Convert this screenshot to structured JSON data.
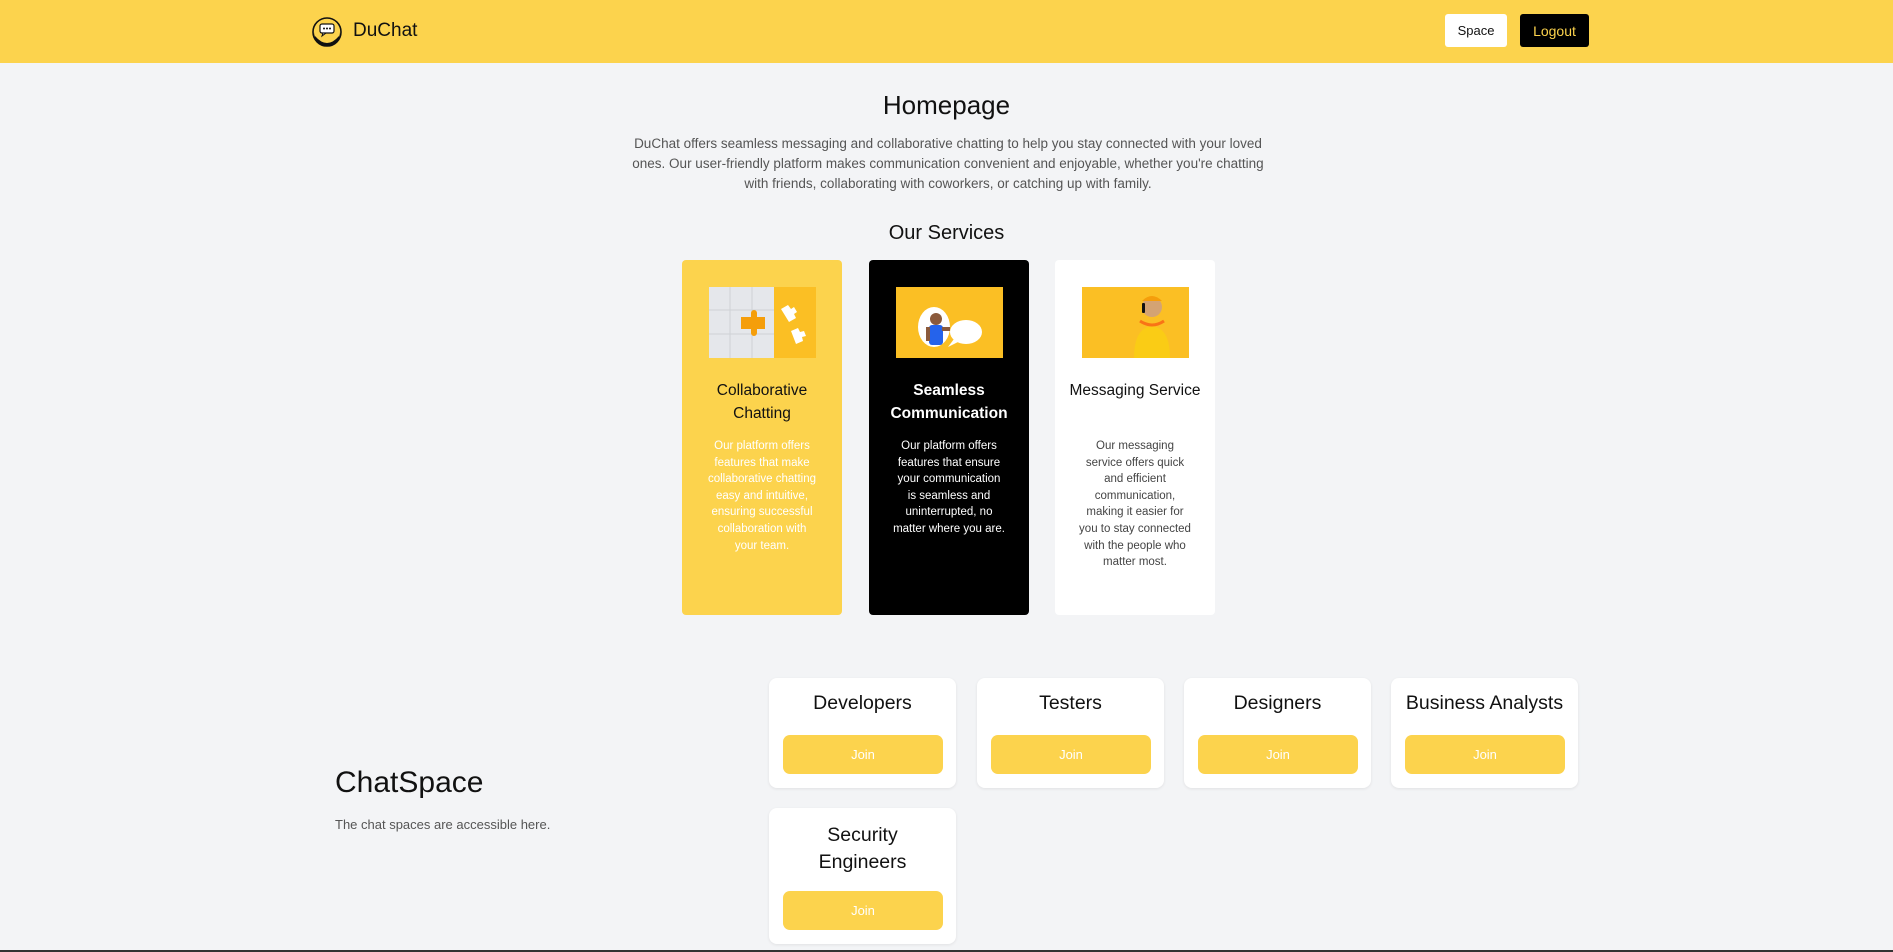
{
  "header": {
    "brand_name": "DuChat",
    "space_label": "Space",
    "logout_label": "Logout"
  },
  "hero": {
    "title": "Homepage",
    "intro": "DuChat offers seamless messaging and collaborative chatting to help you stay connected with your loved ones. Our user-friendly platform makes communication convenient and enjoyable, whether you're chatting with friends, collaborating with coworkers, or catching up with family."
  },
  "services": {
    "title": "Our Services",
    "items": [
      {
        "title": "Collaborative Chatting",
        "description": "Our platform offers features that make collaborative chatting easy and intuitive, ensuring successful collaboration with your team.",
        "image": "puzzle-pieces-image"
      },
      {
        "title": "Seamless Communication",
        "description": "Our platform offers features that ensure your communication is seamless and uninterrupted, no matter where you are.",
        "image": "man-with-speech-bubble-image"
      },
      {
        "title": "Messaging Service",
        "description": "Our messaging service offers quick and efficient communication, making it easier for you to stay connected with the people who matter most.",
        "image": "man-on-phone-image"
      }
    ]
  },
  "chatspace": {
    "title": "ChatSpace",
    "subtitle": "The chat spaces are accessible here.",
    "join_label": "Join",
    "spaces": [
      {
        "name": "Developers"
      },
      {
        "name": "Testers"
      },
      {
        "name": "Designers"
      },
      {
        "name": "Business Analysts"
      },
      {
        "name": "Security Engineers"
      }
    ]
  },
  "colors": {
    "brand_yellow": "#fcd34d",
    "black": "#000000",
    "background": "#f3f4f6"
  }
}
